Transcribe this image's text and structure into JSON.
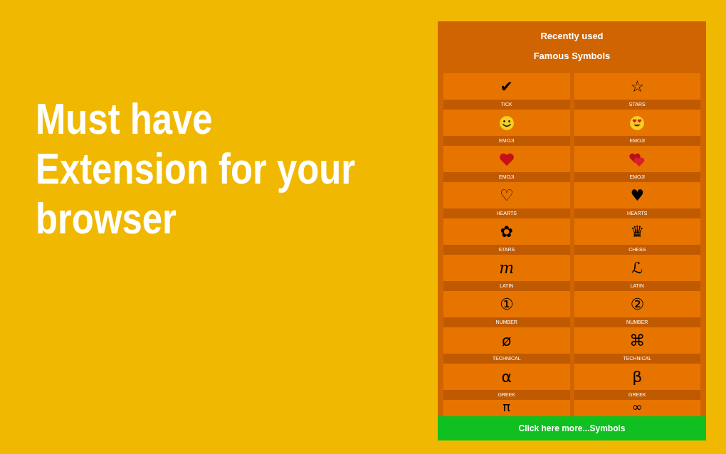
{
  "headline": [
    "Must have",
    "Extension for your",
    "browser"
  ],
  "popup": {
    "recent_title": "Recently used",
    "section_title": "Famous Symbols",
    "tiles": [
      {
        "kind": "glyph",
        "symbol": "✔",
        "label": "TICK"
      },
      {
        "kind": "glyph",
        "symbol": "☆",
        "label": "STARS"
      },
      {
        "kind": "smile",
        "label": "EMOJI"
      },
      {
        "kind": "heart-eyes",
        "label": "EMOJI"
      },
      {
        "kind": "red-heart",
        "label": "EMOJI"
      },
      {
        "kind": "two-hearts",
        "label": "EMOJI"
      },
      {
        "kind": "glyph",
        "symbol": "♡",
        "label": "HEARTS"
      },
      {
        "kind": "glyph",
        "symbol": "♥",
        "label": "HEARTS"
      },
      {
        "kind": "glyph",
        "symbol": "✿",
        "label": "STARS"
      },
      {
        "kind": "glyph",
        "symbol": "♛",
        "label": "CHESS"
      },
      {
        "kind": "script",
        "symbol": "m",
        "label": "LATIN"
      },
      {
        "kind": "glyph",
        "symbol": "ℒ",
        "label": "LATIN"
      },
      {
        "kind": "glyph",
        "symbol": "①",
        "label": "NUMBER"
      },
      {
        "kind": "glyph",
        "symbol": "②",
        "label": "NUMBER"
      },
      {
        "kind": "glyph",
        "symbol": "ø",
        "label": "TECHNICAL"
      },
      {
        "kind": "glyph",
        "symbol": "⌘",
        "label": "TECHNICAL"
      },
      {
        "kind": "glyph",
        "symbol": "α",
        "label": "GREEK"
      },
      {
        "kind": "glyph",
        "symbol": "β",
        "label": "GREEK"
      },
      {
        "kind": "glyph",
        "symbol": "π"
      },
      {
        "kind": "glyph",
        "symbol": "∞"
      }
    ],
    "more_button": "Click here more...Symbols"
  }
}
